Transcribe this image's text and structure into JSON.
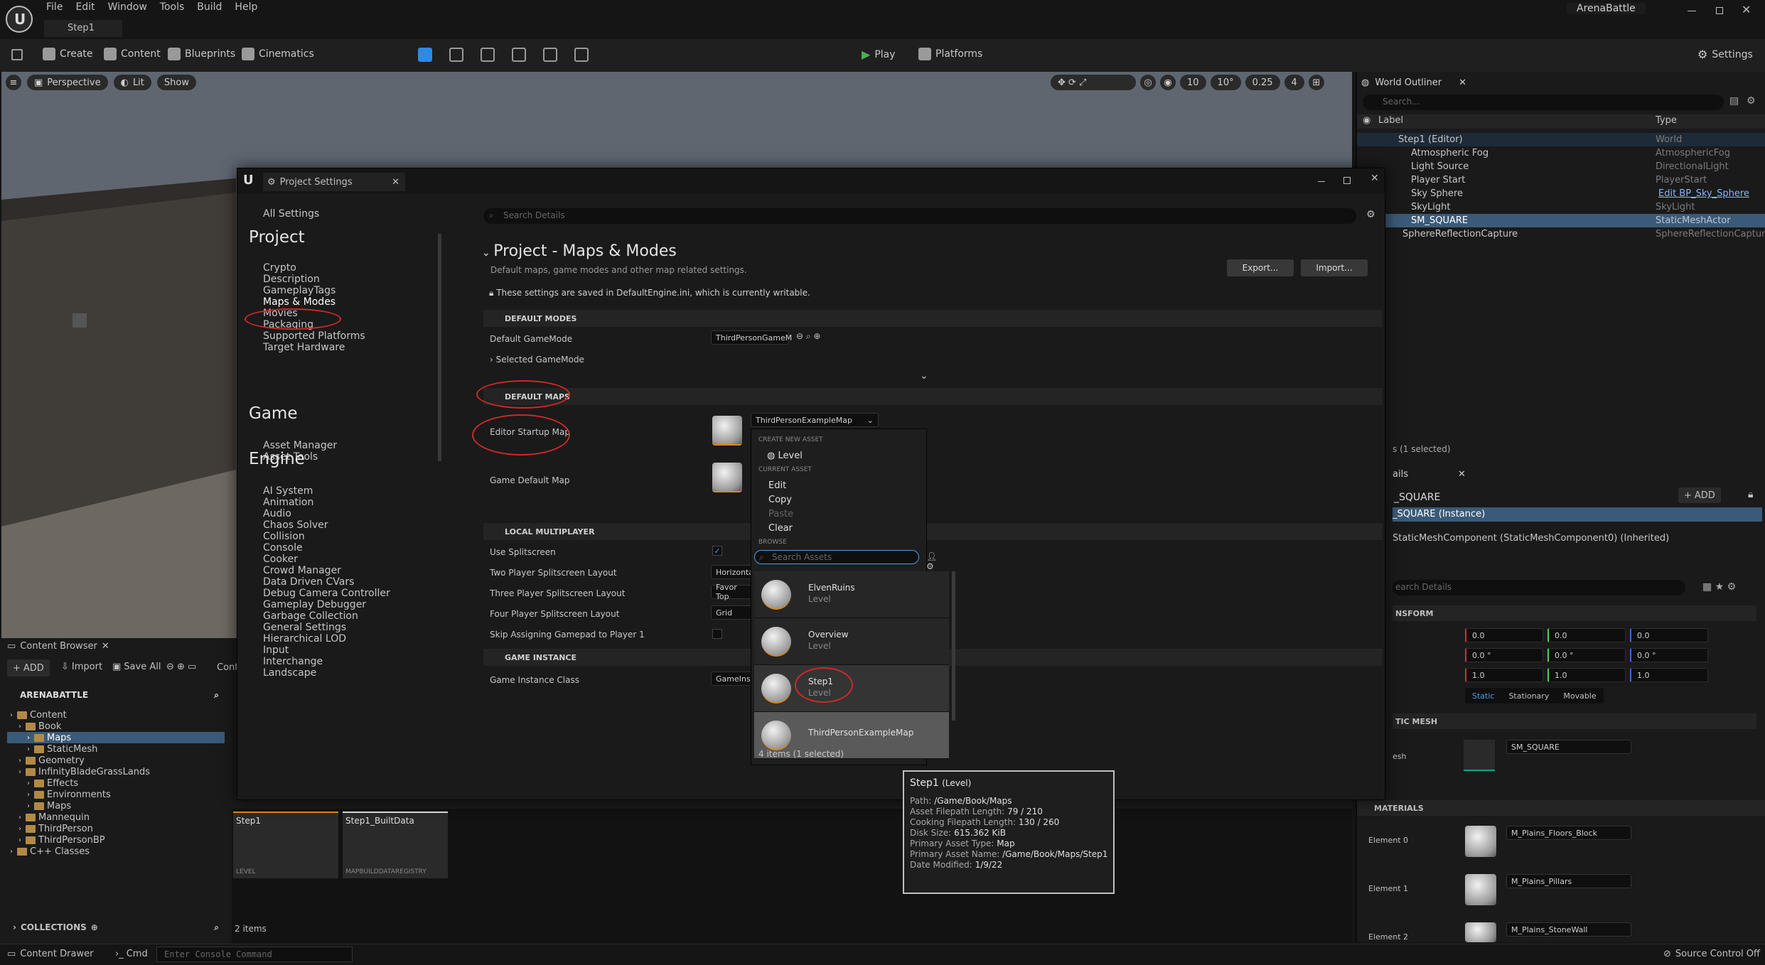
{
  "menu": [
    "File",
    "Edit",
    "Window",
    "Tools",
    "Build",
    "Help"
  ],
  "project_name": "ArenaBattle",
  "level_tab": "Step1",
  "toolbar": {
    "create": "Create",
    "content": "Content",
    "blueprints": "Blueprints",
    "cinematics": "Cinematics",
    "play": "Play",
    "platforms": "Platforms",
    "settings": "Settings"
  },
  "viewport": {
    "perspective": "Perspective",
    "lit": "Lit",
    "show": "Show",
    "grid": "10",
    "angle": "10°",
    "scale": "0.25",
    "cam": "4"
  },
  "outliner": {
    "title": "World Outliner",
    "search": "Search...",
    "col_label": "Label",
    "col_type": "Type",
    "rows": [
      {
        "name": "Step1 (Editor)",
        "type": "World"
      },
      {
        "name": "Atmospheric Fog",
        "type": "AtmosphericFog"
      },
      {
        "name": "Light Source",
        "type": "DirectionalLight"
      },
      {
        "name": "Player Start",
        "type": "PlayerStart"
      },
      {
        "name": "Sky Sphere",
        "type": "Edit BP_Sky_Sphere"
      },
      {
        "name": "SkyLight",
        "type": "SkyLight"
      },
      {
        "name": "SM_SQUARE",
        "type": "StaticMeshActor"
      },
      {
        "name": "SphereReflectionCapture",
        "type": "SphereReflectionCapture"
      }
    ],
    "footer": "s (1 selected)"
  },
  "details": {
    "tab": "ails",
    "actor": "_SQUARE",
    "add": "ADD",
    "instance": "_SQUARE (Instance)",
    "component": "StaticMeshComponent (StaticMeshComponent0) (Inherited)",
    "search": "earch Details",
    "transform": "NSFORM",
    "loc": [
      "0.0",
      "0.0",
      "0.0"
    ],
    "rot": [
      "0.0 °",
      "0.0 °",
      "0.0 °"
    ],
    "scl": [
      "1.0",
      "1.0",
      "1.0"
    ],
    "mob": [
      "Static",
      "Stationary",
      "Movable"
    ],
    "static_mesh": "TIC MESH",
    "mesh_label": "esh",
    "mesh": "SM_SQUARE",
    "materials": "MATERIALS",
    "elements": [
      {
        "label": "Element 0",
        "mat": "M_Plains_Floors_Block"
      },
      {
        "label": "Element 1",
        "mat": "M_Plains_Pillars"
      },
      {
        "label": "Element 2",
        "mat": "M_Plains_StoneWall"
      }
    ]
  },
  "content_browser": {
    "tab": "Content Browser",
    "add": "ADD",
    "import": "Import",
    "save_all": "Save All",
    "path": "Cont",
    "root": "ARENABATTLE",
    "tree": [
      {
        "label": "Content",
        "indent": 0
      },
      {
        "label": "Book",
        "indent": 1
      },
      {
        "label": "Maps",
        "indent": 2
      },
      {
        "label": "StaticMesh",
        "indent": 2
      },
      {
        "label": "Geometry",
        "indent": 1
      },
      {
        "label": "InfinityBladeGrassLands",
        "indent": 1
      },
      {
        "label": "Effects",
        "indent": 2
      },
      {
        "label": "Environments",
        "indent": 2
      },
      {
        "label": "Maps",
        "indent": 2
      },
      {
        "label": "Mannequin",
        "indent": 1
      },
      {
        "label": "ThirdPerson",
        "indent": 1
      },
      {
        "label": "ThirdPersonBP",
        "indent": 1
      },
      {
        "label": "C++ Classes",
        "indent": 0
      }
    ],
    "assets": [
      {
        "name": "Step1",
        "type": "LEVEL"
      },
      {
        "name": "Step1_BuiltData",
        "type": "MAPBUILDDATAREGISTRY"
      }
    ],
    "count": "2 items",
    "collections": "COLLECTIONS"
  },
  "status": {
    "drawer": "Content Drawer",
    "cmd": "Cmd",
    "console": "Enter Console Command",
    "source": "Source Control Off"
  },
  "ps": {
    "title": "Project Settings",
    "search": "Search Details",
    "all": "All Settings",
    "project_h": "Project",
    "project": [
      "Crypto",
      "Description",
      "GameplayTags",
      "Maps & Modes",
      "Movies",
      "Packaging",
      "Supported Platforms",
      "Target Hardware"
    ],
    "game_h": "Game",
    "game": [
      "Asset Manager",
      "Asset Tools"
    ],
    "engine_h": "Engine",
    "engine": [
      "AI System",
      "Animation",
      "Audio",
      "Chaos Solver",
      "Collision",
      "Console",
      "Cooker",
      "Crowd Manager",
      "Data Driven CVars",
      "Debug Camera Controller",
      "Gameplay Debugger",
      "Garbage Collection",
      "General Settings",
      "Hierarchical LOD",
      "Input",
      "Interchange",
      "Landscape"
    ],
    "heading": "Project - Maps & Modes",
    "subtitle": "Default maps, game modes and other map related settings.",
    "export": "Export...",
    "import": "Import...",
    "saved": "These settings are saved in DefaultEngine.ini, which is currently writable.",
    "s_modes": "DEFAULT MODES",
    "default_gamemode": "Default GameMode",
    "gamemode_val": "ThirdPersonGameM",
    "selected_gamemode": "Selected GameMode",
    "s_maps": "DEFAULT MAPS",
    "editor_startup": "Editor Startup Map",
    "startup_val": "ThirdPersonExampleMap",
    "game_default": "Game Default Map",
    "s_local": "LOCAL MULTIPLAYER",
    "use_split": "Use Splitscreen",
    "two": "Two Player Splitscreen Layout",
    "two_v": "Horizontal",
    "three": "Three Player Splitscreen Layout",
    "three_v": "Favor Top",
    "four": "Four Player Splitscreen Layout",
    "four_v": "Grid",
    "skip": "Skip Assigning Gamepad to Player 1",
    "s_instance": "GAME INSTANCE",
    "gi_class": "Game Instance Class",
    "gi_val": "GameInsta"
  },
  "menu_popup": {
    "create_new": "CREATE NEW ASSET",
    "level": "Level",
    "current": "CURRENT ASSET",
    "edit": "Edit",
    "copy": "Copy",
    "paste": "Paste",
    "clear": "Clear",
    "browse": "BROWSE",
    "search": "Search Assets",
    "items": [
      {
        "name": "ElvenRuins",
        "type": "Level"
      },
      {
        "name": "Overview",
        "type": "Level"
      },
      {
        "name": "Step1",
        "type": "Level"
      },
      {
        "name": "ThirdPersonExampleMap",
        "type": ""
      }
    ],
    "count": "4 items (1 selected)"
  },
  "tooltip": {
    "title": "Step1",
    "kind": "(Level)",
    "lines": [
      {
        "k": "Path:",
        "v": "/Game/Book/Maps"
      },
      {
        "k": "Asset Filepath Length:",
        "v": "79 / 210"
      },
      {
        "k": "Cooking Filepath Length:",
        "v": "130 / 260"
      },
      {
        "k": "Disk Size:",
        "v": "615.362 KiB"
      },
      {
        "k": "Primary Asset Type:",
        "v": "Map"
      },
      {
        "k": "Primary Asset Name:",
        "v": "/Game/Book/Maps/Step1"
      },
      {
        "k": "Date Modified:",
        "v": "1/9/22"
      }
    ]
  }
}
